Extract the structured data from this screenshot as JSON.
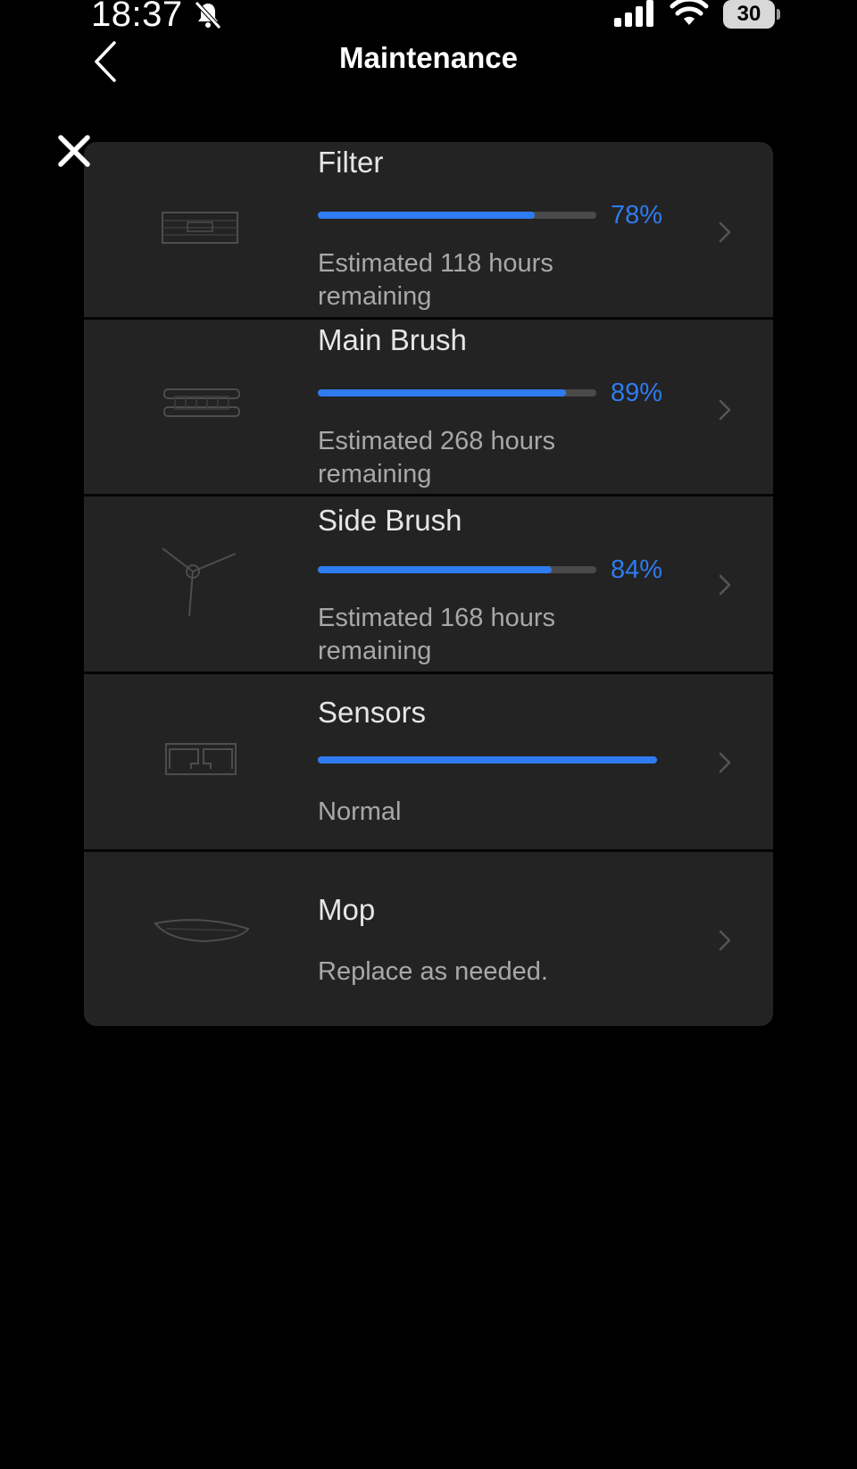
{
  "status_bar": {
    "time": "18:37",
    "battery": "30"
  },
  "header": {
    "title": "Maintenance"
  },
  "icons": {
    "back": "chevron-left-icon",
    "close": "close-icon",
    "row_arrow": "chevron-right-icon"
  },
  "colors": {
    "accent": "#2F7BF0",
    "panel": "#232323",
    "background": "#000000"
  },
  "items": [
    {
      "name": "Filter",
      "percent_label": "78%",
      "progress": 0.78,
      "description": "Estimated 118 hours remaining",
      "icon": "filter-icon"
    },
    {
      "name": "Main Brush",
      "percent_label": "89%",
      "progress": 0.89,
      "description": "Estimated 268 hours remaining",
      "icon": "main-brush-icon"
    },
    {
      "name": "Side Brush",
      "percent_label": "84%",
      "progress": 0.84,
      "description": "Estimated 168 hours remaining",
      "icon": "side-brush-icon"
    },
    {
      "name": "Sensors",
      "progress": 1.0,
      "description": "Normal",
      "icon": "sensors-icon"
    },
    {
      "name": "Mop",
      "description": "Replace as needed.",
      "icon": "mop-icon"
    }
  ]
}
